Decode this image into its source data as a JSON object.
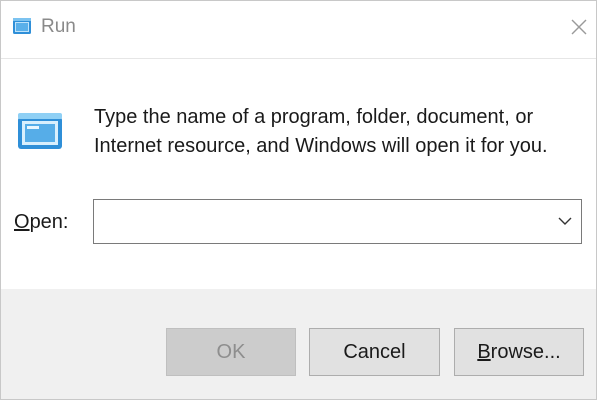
{
  "window": {
    "title": "Run",
    "title_icon": "run-icon",
    "close_icon": "close-icon"
  },
  "body": {
    "icon": "run-icon",
    "description": "Type the name of a program, folder, document, or Internet resource, and Windows will open it for you."
  },
  "open_field": {
    "label_access_key": "O",
    "label_rest": "pen:",
    "value": "",
    "dropdown_icon": "chevron-down-icon"
  },
  "buttons": {
    "ok_label": "OK",
    "cancel_label": "Cancel",
    "browse_access_key": "B",
    "browse_rest": "rowse..."
  },
  "colors": {
    "footer_bg": "#f0f0f0",
    "button_bg": "#e1e1e1",
    "button_disabled_bg": "#cccccc",
    "icon_blue": "#2f8fd8"
  }
}
